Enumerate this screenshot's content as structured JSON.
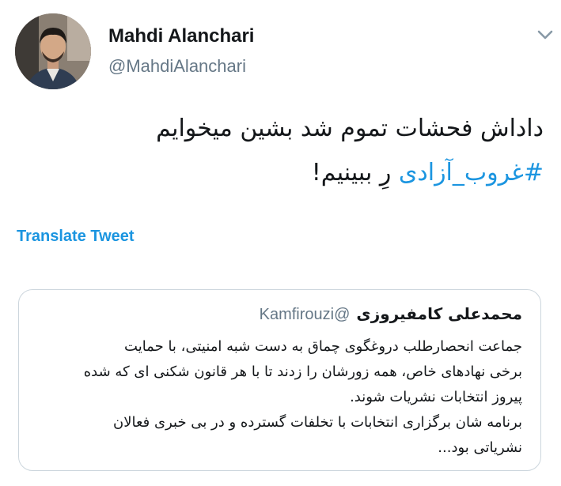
{
  "tweet": {
    "author": {
      "name": "Mahdi Alanchari",
      "handle": "@MahdiAlanchari"
    },
    "text_line1": "داداش فحشات تموم شد بشین میخوایم",
    "hashtag": "#غروب_آزادی",
    "text_line2_rest": " رِ ببینیم!",
    "translate_label": "Translate Tweet"
  },
  "quoted_tweet": {
    "author_name": "محمدعلی کامفیروزی",
    "author_handle": "@Kamfirouzi",
    "text_lines": [
      "جماعت انحصارطلب دروغگوی چماق به دست شبه امنیتی، با حمایت",
      "برخی نهادهای خاص، همه زورشان را زدند تا با هر قانون شکنی ای که شده",
      "پیروز انتخابات نشریات شوند.",
      "برنامه شان برگزاری انتخابات با تخلفات گسترده و در بی خبری فعالان",
      "نشریاتی بود..."
    ]
  },
  "icons": {
    "menu": "chevron-down-icon",
    "avatar": "profile-photo"
  },
  "colors": {
    "link": "#1b95e0",
    "secondary_text": "#657786",
    "border": "#ccd6dd"
  }
}
